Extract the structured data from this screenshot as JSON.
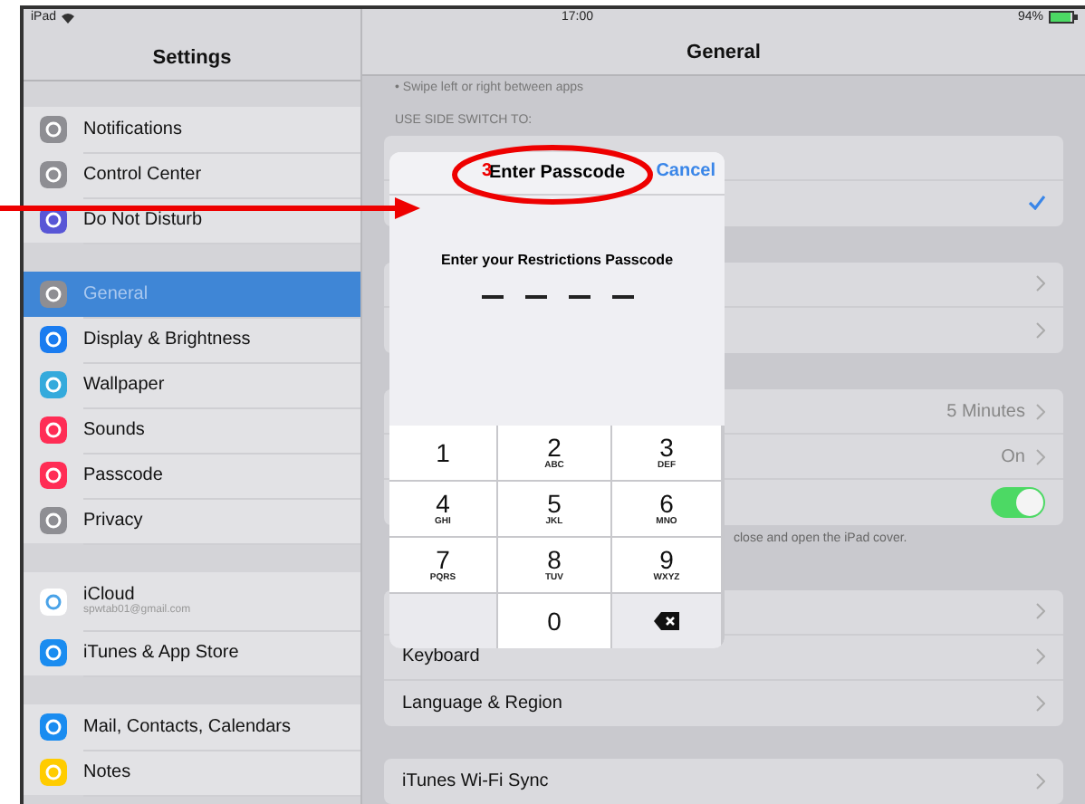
{
  "status_bar": {
    "device": "iPad",
    "time": "17:00",
    "battery": "94%"
  },
  "sidebar": {
    "title": "Settings",
    "groups": [
      [
        {
          "label": "Notifications",
          "selected": false,
          "color": "#8e8e93"
        },
        {
          "label": "Control Center",
          "selected": false,
          "color": "#8e8e93"
        },
        {
          "label": "Do Not Disturb",
          "selected": false,
          "color": "#5856d6"
        }
      ],
      [
        {
          "label": "General",
          "selected": true,
          "color": "#8e8e93"
        },
        {
          "label": "Display & Brightness",
          "selected": false,
          "color": "#1a7cf0"
        },
        {
          "label": "Wallpaper",
          "selected": false,
          "color": "#34aadc"
        },
        {
          "label": "Sounds",
          "selected": false,
          "color": "#ff2d55"
        },
        {
          "label": "Passcode",
          "selected": false,
          "color": "#ff2d55"
        },
        {
          "label": "Privacy",
          "selected": false,
          "color": "#8e8e93"
        }
      ],
      [
        {
          "label": "iCloud",
          "subtitle": "spwtab01@gmail.com",
          "selected": false,
          "color": "#ffffff"
        },
        {
          "label": "iTunes & App Store",
          "selected": false,
          "color": "#1a8cf0"
        }
      ],
      [
        {
          "label": "Mail, Contacts, Calendars",
          "selected": false,
          "color": "#1a8cf0"
        },
        {
          "label": "Notes",
          "selected": false,
          "color": "#ffcc00"
        }
      ]
    ]
  },
  "detail": {
    "title": "General",
    "note": "• Swipe left or right between apps",
    "sections": [
      {
        "header": "USE SIDE SWITCH TO:",
        "rows": [
          {
            "kind": "plain"
          },
          {
            "kind": "check"
          }
        ]
      },
      {
        "rows": [
          {
            "kind": "chevron"
          },
          {
            "kind": "chevron"
          }
        ]
      },
      {
        "rows": [
          {
            "kind": "chevron",
            "value": "5 Minutes"
          },
          {
            "kind": "chevron",
            "value": "On"
          },
          {
            "kind": "toggle",
            "on": true
          }
        ],
        "footer": "close and open the iPad cover."
      },
      {
        "rows": [
          {
            "kind": "chevron"
          },
          {
            "kind": "chevron",
            "label": "Keyboard"
          },
          {
            "kind": "chevron",
            "label": "Language & Region"
          }
        ]
      },
      {
        "rows": [
          {
            "kind": "chevron",
            "label": "iTunes Wi-Fi Sync"
          }
        ]
      }
    ]
  },
  "modal": {
    "title": "Enter Passcode",
    "cancel": "Cancel",
    "prompt": "Enter your Restrictions Passcode",
    "keys": [
      {
        "kind": "digit",
        "digit": "1"
      },
      {
        "kind": "digit",
        "digit": "2",
        "letters": "ABC"
      },
      {
        "kind": "digit",
        "digit": "3",
        "letters": "DEF"
      },
      {
        "kind": "digit",
        "digit": "4",
        "letters": "GHI"
      },
      {
        "kind": "digit",
        "digit": "5",
        "letters": "JKL"
      },
      {
        "kind": "digit",
        "digit": "6",
        "letters": "MNO"
      },
      {
        "kind": "digit",
        "digit": "7",
        "letters": "PQRS"
      },
      {
        "kind": "digit",
        "digit": "8",
        "letters": "TUV"
      },
      {
        "kind": "digit",
        "digit": "9",
        "letters": "WXYZ"
      },
      {
        "kind": "blank"
      },
      {
        "kind": "digit",
        "digit": "0"
      },
      {
        "kind": "delete"
      }
    ]
  },
  "annotation": {
    "step": "3"
  }
}
